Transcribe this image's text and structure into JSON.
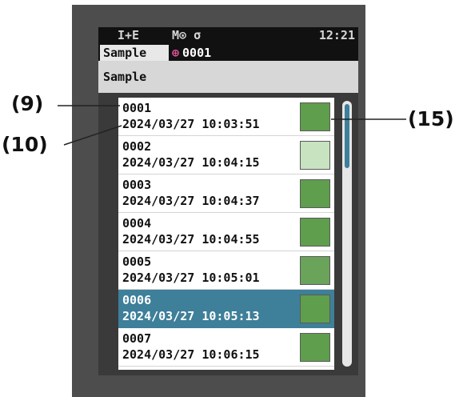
{
  "status_bar": {
    "mode": "I+E",
    "icons": "M⊙ σ",
    "time": "12:21"
  },
  "tabs": {
    "active_label": "Sample",
    "current_target": "0001",
    "target_icon": "target-icon"
  },
  "header": {
    "title": "Sample"
  },
  "samples": [
    {
      "id": "0001",
      "timestamp": "2024/03/27  10:03:51",
      "color": "#5f9e4d"
    },
    {
      "id": "0002",
      "timestamp": "2024/03/27  10:04:15",
      "color": "#c7e3c0"
    },
    {
      "id": "0003",
      "timestamp": "2024/03/27  10:04:37",
      "color": "#5f9e4d"
    },
    {
      "id": "0004",
      "timestamp": "2024/03/27  10:04:55",
      "color": "#5f9e4d"
    },
    {
      "id": "0005",
      "timestamp": "2024/03/27  10:05:01",
      "color": "#6aa35a"
    },
    {
      "id": "0006",
      "timestamp": "2024/03/27  10:05:13",
      "color": "#5f9e4d",
      "selected": true
    },
    {
      "id": "0007",
      "timestamp": "2024/03/27  10:06:15",
      "color": "#5f9e4d"
    }
  ],
  "callouts": {
    "c9": "(9)",
    "c10": "(10)",
    "c15": "(15)"
  }
}
